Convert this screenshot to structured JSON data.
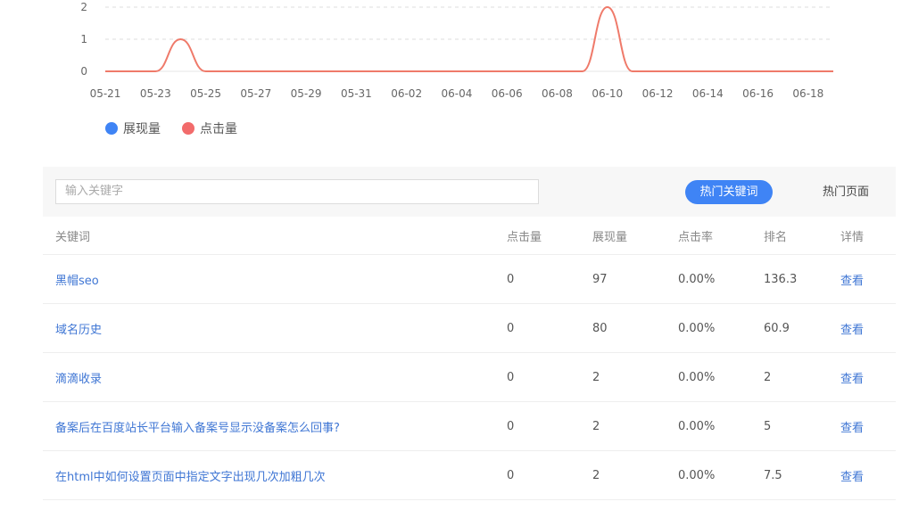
{
  "chart_data": {
    "type": "line",
    "x_ticks": [
      "05-21",
      "05-23",
      "05-25",
      "05-27",
      "05-29",
      "05-31",
      "06-02",
      "06-04",
      "06-06",
      "06-08",
      "06-10",
      "06-12",
      "06-14",
      "06-16",
      "06-18"
    ],
    "y_ticks": [
      "0",
      "1",
      "2"
    ],
    "ylim": [
      0,
      2
    ],
    "series": [
      {
        "name": "展现量",
        "color": "#3f84f5",
        "values": []
      },
      {
        "name": "点击量",
        "color": "#ef7a6a",
        "points": [
          [
            "05-21",
            0
          ],
          [
            "05-22",
            0
          ],
          [
            "05-23",
            0
          ],
          [
            "05-24",
            1
          ],
          [
            "05-25",
            0
          ],
          [
            "05-26",
            0
          ],
          [
            "05-27",
            0
          ],
          [
            "05-28",
            0
          ],
          [
            "05-29",
            0
          ],
          [
            "05-30",
            0
          ],
          [
            "05-31",
            0
          ],
          [
            "06-01",
            0
          ],
          [
            "06-02",
            0
          ],
          [
            "06-03",
            0
          ],
          [
            "06-04",
            0
          ],
          [
            "06-05",
            0
          ],
          [
            "06-06",
            0
          ],
          [
            "06-07",
            0
          ],
          [
            "06-08",
            0
          ],
          [
            "06-09",
            0
          ],
          [
            "06-10",
            2
          ],
          [
            "06-11",
            0
          ],
          [
            "06-12",
            0
          ],
          [
            "06-13",
            0
          ],
          [
            "06-14",
            0
          ],
          [
            "06-15",
            0
          ],
          [
            "06-16",
            0
          ],
          [
            "06-17",
            0
          ],
          [
            "06-18",
            0
          ],
          [
            "06-19",
            0
          ]
        ]
      }
    ],
    "grid": "horizontal-dashed"
  },
  "legend": [
    {
      "label": "展现量",
      "color": "#3f84f5"
    },
    {
      "label": "点击量",
      "color": "#f26b6b"
    }
  ],
  "toolbar": {
    "search_placeholder": "输入关键字",
    "hot_keywords_label": "热门关键词",
    "hot_pages_label": "热门页面"
  },
  "table": {
    "headers": [
      "关键词",
      "点击量",
      "展现量",
      "点击率",
      "排名",
      "详情"
    ],
    "rows": [
      {
        "keyword": "黑帽seo",
        "clicks": "0",
        "impressions": "97",
        "ctr": "0.00%",
        "rank": "136.3",
        "detail": "查看"
      },
      {
        "keyword": "域名历史",
        "clicks": "0",
        "impressions": "80",
        "ctr": "0.00%",
        "rank": "60.9",
        "detail": "查看"
      },
      {
        "keyword": "滴滴收录",
        "clicks": "0",
        "impressions": "2",
        "ctr": "0.00%",
        "rank": "2",
        "detail": "查看"
      },
      {
        "keyword": "备案后在百度站长平台输入备案号显示没备案怎么回事?",
        "clicks": "0",
        "impressions": "2",
        "ctr": "0.00%",
        "rank": "5",
        "detail": "查看"
      },
      {
        "keyword": "在html中如何设置页面中指定文字出现几次加粗几次",
        "clicks": "0",
        "impressions": "2",
        "ctr": "0.00%",
        "rank": "7.5",
        "detail": "查看"
      }
    ]
  }
}
